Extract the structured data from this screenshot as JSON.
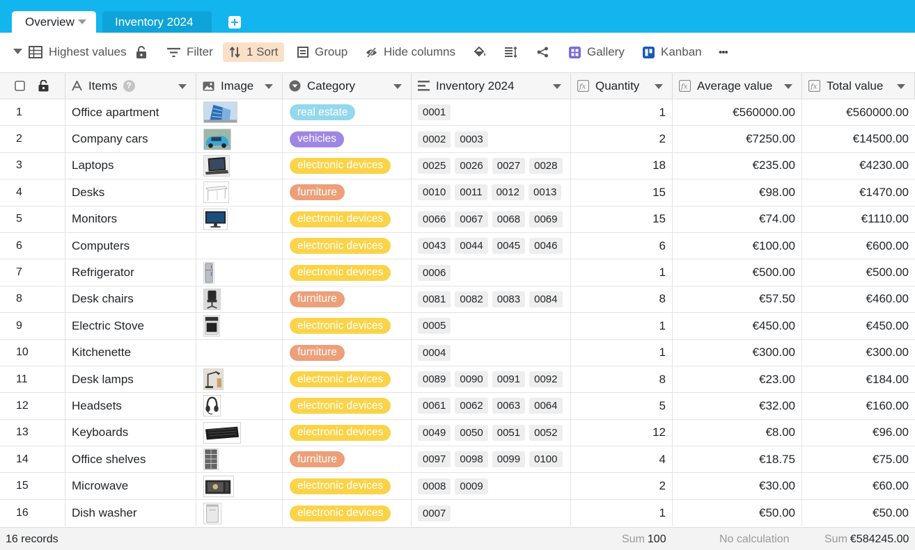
{
  "tabs": {
    "active_label": "Overview",
    "inactive_label": "Inventory 2024"
  },
  "toolbar": {
    "view_label": "Highest values",
    "filter_label": "Filter",
    "sort_label": "1 Sort",
    "group_label": "Group",
    "hide_columns_label": "Hide columns",
    "gallery_label": "Gallery",
    "kanban_label": "Kanban",
    "more_label": "•••"
  },
  "columns": {
    "items": "Items",
    "image": "Image",
    "category": "Category",
    "inventory": "Inventory 2024",
    "quantity": "Quantity",
    "average_value": "Average value",
    "total_value": "Total value",
    "help": "?"
  },
  "category_colors": {
    "real estate": "#93d8ec",
    "vehicles": "#9e86e4",
    "electronic devices": "#fbd348",
    "furniture": "#ec9f78"
  },
  "rows": [
    {
      "n": "1",
      "item": "Office apartment",
      "image": "building",
      "category": "real estate",
      "inv": [
        "0001"
      ],
      "qty": "1",
      "avg": "€560000.00",
      "total": "€560000.00"
    },
    {
      "n": "2",
      "item": "Company cars",
      "image": "car",
      "category": "vehicles",
      "inv": [
        "0002",
        "0003"
      ],
      "qty": "2",
      "avg": "€7250.00",
      "total": "€14500.00"
    },
    {
      "n": "3",
      "item": "Laptops",
      "image": "laptop",
      "category": "electronic devices",
      "inv": [
        "0025",
        "0026",
        "0027",
        "0028"
      ],
      "qty": "18",
      "avg": "€235.00",
      "total": "€4230.00"
    },
    {
      "n": "4",
      "item": "Desks",
      "image": "desk",
      "category": "furniture",
      "inv": [
        "0010",
        "0011",
        "0012",
        "0013"
      ],
      "qty": "15",
      "avg": "€98.00",
      "total": "€1470.00"
    },
    {
      "n": "5",
      "item": "Monitors",
      "image": "monitor",
      "category": "electronic devices",
      "inv": [
        "0066",
        "0067",
        "0068",
        "0069"
      ],
      "qty": "15",
      "avg": "€74.00",
      "total": "€1110.00"
    },
    {
      "n": "6",
      "item": "Computers",
      "image": "",
      "category": "electronic devices",
      "inv": [
        "0043",
        "0044",
        "0045",
        "0046"
      ],
      "qty": "6",
      "avg": "€100.00",
      "total": "€600.00"
    },
    {
      "n": "7",
      "item": "Refrigerator",
      "image": "fridge",
      "category": "electronic devices",
      "inv": [
        "0006"
      ],
      "qty": "1",
      "avg": "€500.00",
      "total": "€500.00"
    },
    {
      "n": "8",
      "item": "Desk chairs",
      "image": "chair",
      "category": "furniture",
      "inv": [
        "0081",
        "0082",
        "0083",
        "0084"
      ],
      "qty": "8",
      "avg": "€57.50",
      "total": "€460.00"
    },
    {
      "n": "9",
      "item": "Electric Stove",
      "image": "stove",
      "category": "electronic devices",
      "inv": [
        "0005"
      ],
      "qty": "1",
      "avg": "€450.00",
      "total": "€450.00"
    },
    {
      "n": "10",
      "item": "Kitchenette",
      "image": "",
      "category": "furniture",
      "inv": [
        "0004"
      ],
      "qty": "1",
      "avg": "€300.00",
      "total": "€300.00"
    },
    {
      "n": "11",
      "item": "Desk lamps",
      "image": "lamp",
      "category": "electronic devices",
      "inv": [
        "0089",
        "0090",
        "0091",
        "0092"
      ],
      "qty": "8",
      "avg": "€23.00",
      "total": "€184.00"
    },
    {
      "n": "12",
      "item": "Headsets",
      "image": "headset",
      "category": "electronic devices",
      "inv": [
        "0061",
        "0062",
        "0063",
        "0064"
      ],
      "qty": "5",
      "avg": "€32.00",
      "total": "€160.00"
    },
    {
      "n": "13",
      "item": "Keyboards",
      "image": "keyboard",
      "category": "electronic devices",
      "inv": [
        "0049",
        "0050",
        "0051",
        "0052"
      ],
      "qty": "12",
      "avg": "€8.00",
      "total": "€96.00"
    },
    {
      "n": "14",
      "item": "Office shelves",
      "image": "shelf",
      "category": "furniture",
      "inv": [
        "0097",
        "0098",
        "0099",
        "0100"
      ],
      "qty": "4",
      "avg": "€18.75",
      "total": "€75.00"
    },
    {
      "n": "15",
      "item": "Microwave",
      "image": "microwave",
      "category": "electronic devices",
      "inv": [
        "0008",
        "0009"
      ],
      "qty": "2",
      "avg": "€30.00",
      "total": "€60.00"
    },
    {
      "n": "16",
      "item": "Dish washer",
      "image": "dishwasher",
      "category": "electronic devices",
      "inv": [
        "0007"
      ],
      "qty": "1",
      "avg": "€50.00",
      "total": "€50.00"
    }
  ],
  "footer": {
    "records": "16 records",
    "sum_label_1": "Sum",
    "sum_value_1": "100",
    "no_calc": "No calculation",
    "sum_label_2": "Sum",
    "sum_value_2": "€584245.00"
  }
}
